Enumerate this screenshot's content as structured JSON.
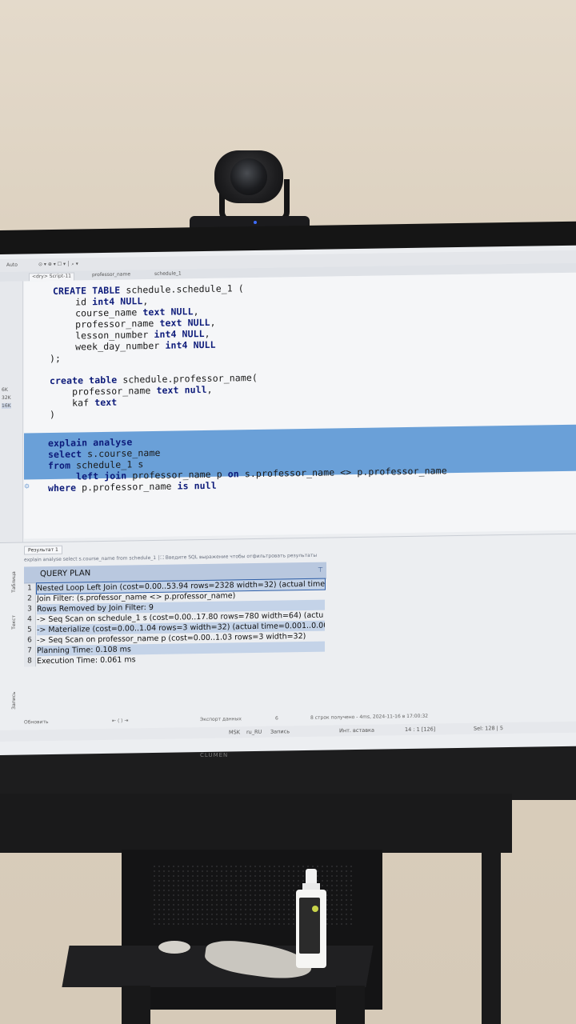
{
  "menubar": {
    "left_label": "Auto"
  },
  "tabs": [
    {
      "label": "<dry> Script-11"
    },
    {
      "label": "professor_name"
    },
    {
      "label": "schedule_1"
    }
  ],
  "gutter_stats": [
    "6K",
    "32K",
    "16K"
  ],
  "code": {
    "l1a": "CREATE TABLE",
    "l1b": " schedule.schedule_1 (",
    "l2a": "    id ",
    "l2b": "int4 NULL",
    "l2c": ",",
    "l3a": "    course_name ",
    "l3b": "text NULL",
    "l3c": ",",
    "l4a": "    professor_name ",
    "l4b": "text NULL",
    "l4c": ",",
    "l5a": "    lesson_number ",
    "l5b": "int4 NULL",
    "l5c": ",",
    "l6a": "    week_day_number ",
    "l6b": "int4 NULL",
    "l7": ");",
    "l9a": "create table",
    "l9b": " schedule.professor_name(",
    "l10a": "    professor_name ",
    "l10b": "text null",
    "l10c": ",",
    "l11a": "    kaf ",
    "l11b": "text",
    "l12": ")",
    "l14": "explain analyse",
    "l15a": "select",
    "l15b": " s.course_name",
    "l16a": "from",
    "l16b": " schedule_1 s",
    "l17a": "     left join",
    "l17b": " professor_name p ",
    "l17c": "on",
    "l17d": " s.professor_name <> p.professor_name",
    "l18a": "where",
    "l18b": " p.professor_name ",
    "l18c": "is null"
  },
  "results": {
    "tab_label": "Результат 1",
    "filter_query": "explain analyse select s.course_name from schedule_1",
    "filter_placeholder": "Введите SQL выражение чтобы отфильтровать результаты",
    "column": "QUERY PLAN",
    "side_labels": [
      "Таблица",
      "Текст",
      "Запись"
    ],
    "rows": [
      {
        "n": "1",
        "text": "Nested Loop Left Join  (cost=0.00..53.94 rows=2328 width=32) (actual time"
      },
      {
        "n": "2",
        "text": "  Join Filter: (s.professor_name <> p.professor_name)"
      },
      {
        "n": "3",
        "text": "  Rows Removed by Join Filter: 9"
      },
      {
        "n": "4",
        "text": "  ->  Seq Scan on schedule_1 s  (cost=0.00..17.80 rows=780 width=64) (actu"
      },
      {
        "n": "5",
        "text": "  ->  Materialize  (cost=0.00..1.04 rows=3 width=32) (actual time=0.001..0.00"
      },
      {
        "n": "6",
        "text": "        ->  Seq Scan on professor_name p  (cost=0.00..1.03 rows=3 width=32)"
      },
      {
        "n": "7",
        "text": "Planning Time: 0.108 ms"
      },
      {
        "n": "8",
        "text": "Execution Time: 0.061 ms"
      }
    ]
  },
  "statusbar": {
    "refresh": "Обновить",
    "export": "Экспорт данных",
    "count": "6",
    "rows_fetched": "8 строк получено - 4ms, 2024-11-16 в 17:00:32"
  },
  "bottombar": {
    "tz": "MSK",
    "locale": "ru_RU",
    "mode": "Запись",
    "insert": "Инт. вставка",
    "pos": "14 : 1 [126]",
    "sel": "Sel: 128 | 5"
  },
  "monitor_brand": "CLUMEN"
}
